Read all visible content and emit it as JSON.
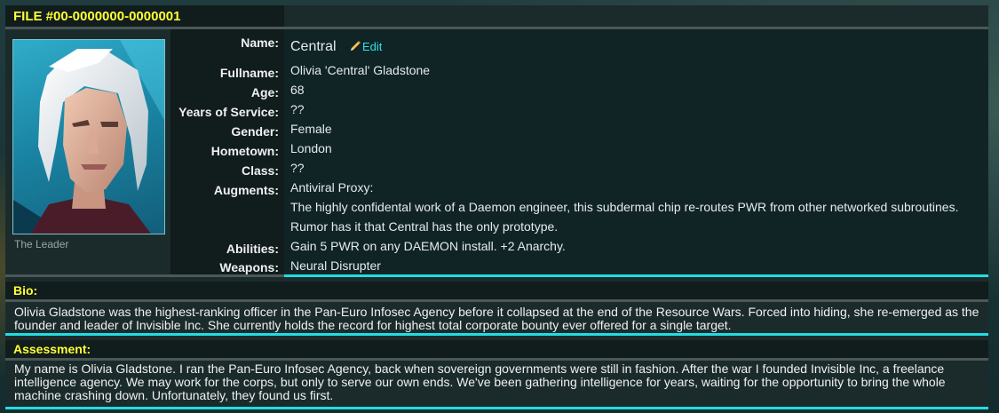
{
  "file": {
    "title": "FILE #00-0000000-0000001"
  },
  "portrait": {
    "caption": "The Leader"
  },
  "edit_label": "Edit",
  "fields": {
    "name": {
      "label": "Name:",
      "value": "Central"
    },
    "fullname": {
      "label": "Fullname:",
      "value": "Olivia 'Central' Gladstone"
    },
    "age": {
      "label": "Age:",
      "value": "68"
    },
    "service": {
      "label": "Years of Service:",
      "value": "??"
    },
    "gender": {
      "label": "Gender:",
      "value": "Female"
    },
    "hometown": {
      "label": "Hometown:",
      "value": "London"
    },
    "class": {
      "label": "Class:",
      "value": "??"
    },
    "augments": {
      "label": "Augments:",
      "lines": [
        "Antiviral Proxy:",
        "The highly confidental work of a Daemon engineer, this subdermal chip re-routes PWR from other networked subroutines.",
        "Rumor has it that Central has the only prototype."
      ]
    },
    "abilities": {
      "label": "Abilities:",
      "value": "Gain 5 PWR on any DAEMON install. +2 Anarchy."
    },
    "weapons": {
      "label": "Weapons:",
      "value": "Neural Disrupter"
    }
  },
  "bio": {
    "heading": "Bio:",
    "text": "Olivia Gladstone was the highest-ranking officer in the Pan-Euro Infosec Agency before it collapsed at the end of the Resource Wars. Forced into hiding, she re-emerged as the founder and leader of Invisible Inc. She currently holds the record for highest total corporate bounty ever offered for a single target."
  },
  "assessment": {
    "heading": "Assessment:",
    "text": "My name is Olivia Gladstone. I ran the Pan-Euro Infosec Agency, back when sovereign governments were still in fashion. After the war I founded Invisible Inc, a freelance intelligence agency. We may work for the corps, but only to serve our own ends. We've been gathering intelligence for years, waiting for the opportunity to bring the whole machine crashing down. Unfortunately, they found us first."
  },
  "colors": {
    "accent": "#22dde3",
    "heading": "#ffff33",
    "link": "#2fe0e6"
  },
  "icons": {
    "edit": "pencil-icon"
  }
}
